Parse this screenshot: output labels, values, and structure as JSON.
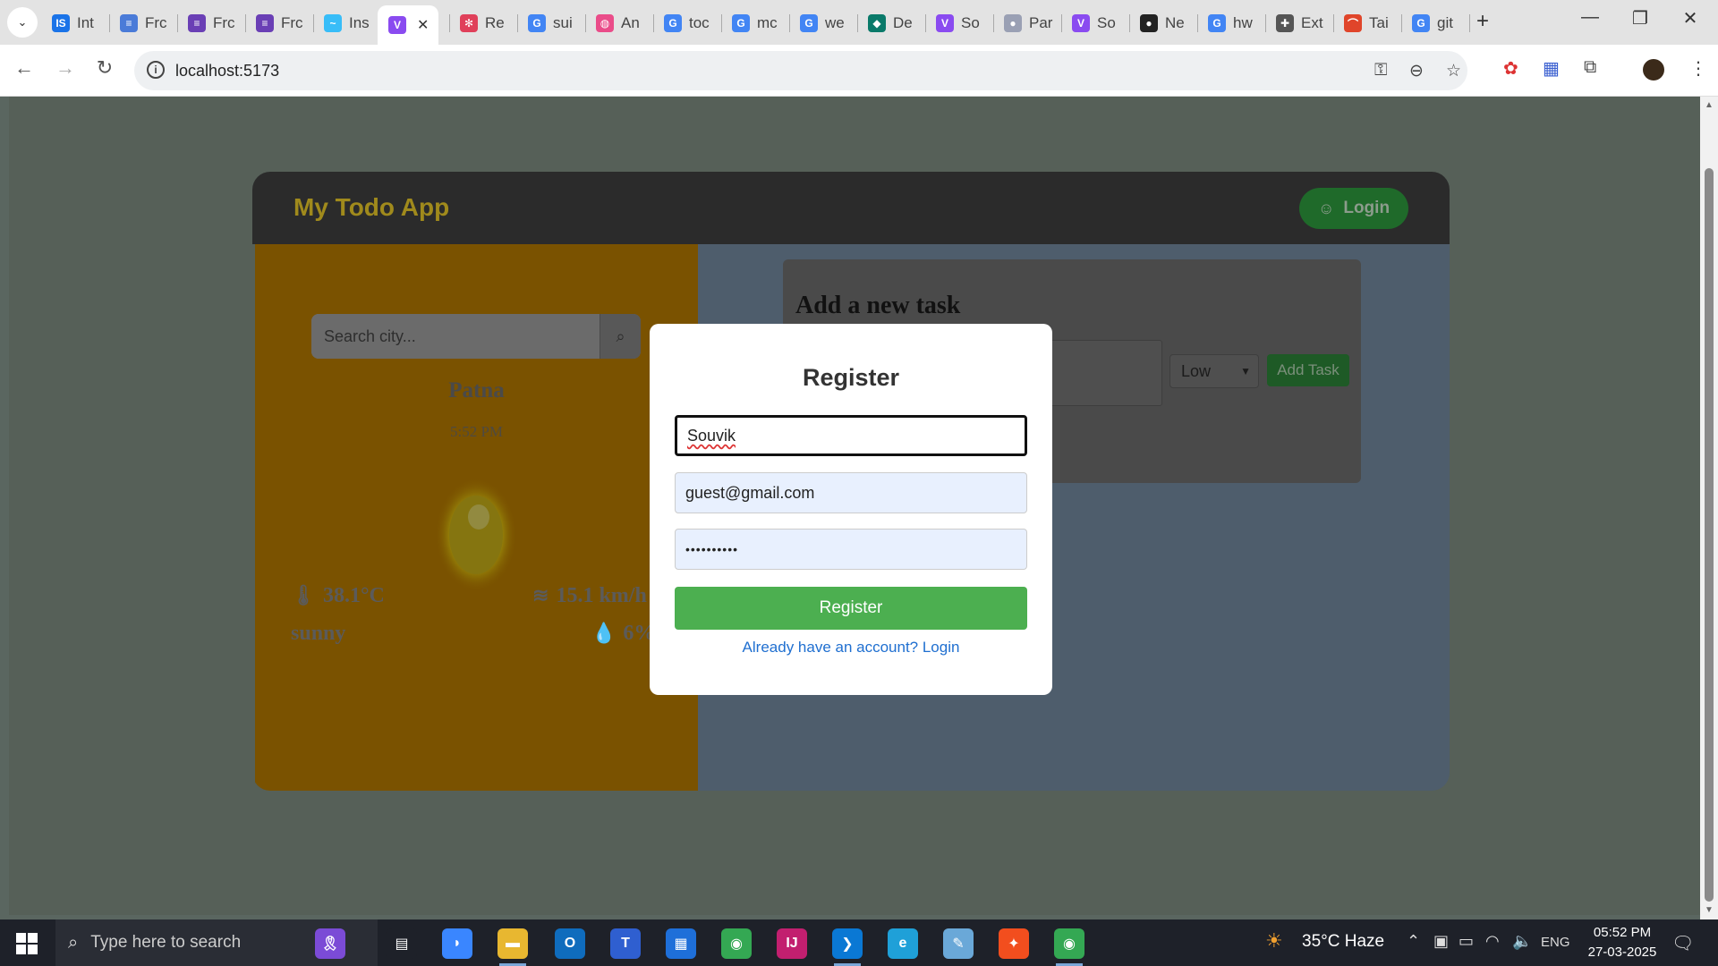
{
  "browser": {
    "tabs": [
      {
        "title": "Int",
        "icon": "indeed-icon",
        "color": "#1a73e8",
        "glyph": "IS"
      },
      {
        "title": "Frc",
        "icon": "docs-icon",
        "color": "#4a7bd8",
        "glyph": "≡"
      },
      {
        "title": "Frc",
        "icon": "forms-icon",
        "color": "#6a3fb5",
        "glyph": "≡"
      },
      {
        "title": "Frc",
        "icon": "forms-icon",
        "color": "#6a3fb5",
        "glyph": "≡"
      },
      {
        "title": "Ins",
        "icon": "tailwind-icon",
        "color": "#38bdf8",
        "glyph": "~"
      },
      {
        "title": "",
        "icon": "vite-icon",
        "color": "#8a4bf0",
        "glyph": "V",
        "active": true
      },
      {
        "title": "Re",
        "icon": "react-icon",
        "color": "#e0405a",
        "glyph": "✻"
      },
      {
        "title": "sui",
        "icon": "google-icon",
        "color": "#4285f4",
        "glyph": "G"
      },
      {
        "title": "An",
        "icon": "dribbble-icon",
        "color": "#ea4c89",
        "glyph": "◍"
      },
      {
        "title": "toc",
        "icon": "google-icon",
        "color": "#4285f4",
        "glyph": "G"
      },
      {
        "title": "mc",
        "icon": "google-icon",
        "color": "#4285f4",
        "glyph": "G"
      },
      {
        "title": "we",
        "icon": "google-icon",
        "color": "#4285f4",
        "glyph": "G"
      },
      {
        "title": "De",
        "icon": "deepseek-icon",
        "color": "#0a7a6a",
        "glyph": "◆"
      },
      {
        "title": "So",
        "icon": "vite-icon",
        "color": "#8a4bf0",
        "glyph": "V"
      },
      {
        "title": "Par",
        "icon": "globe-icon",
        "color": "#9aa0b4",
        "glyph": "●"
      },
      {
        "title": "So",
        "icon": "vite-icon",
        "color": "#8a4bf0",
        "glyph": "V"
      },
      {
        "title": "Ne",
        "icon": "github-icon",
        "color": "#222222",
        "glyph": "●"
      },
      {
        "title": "hw",
        "icon": "google-icon",
        "color": "#4285f4",
        "glyph": "G"
      },
      {
        "title": "Ext",
        "icon": "puzzle-icon",
        "color": "#555555",
        "glyph": "✚"
      },
      {
        "title": "Tai",
        "icon": "rainbow-icon",
        "color": "#e0452a",
        "glyph": "⌒"
      },
      {
        "title": "git",
        "icon": "google-icon",
        "color": "#4285f4",
        "glyph": "G"
      }
    ],
    "new_tab": "+",
    "url": "localhost:5173",
    "controls": {
      "minimize": "—",
      "restore": "❐",
      "close": "✕"
    }
  },
  "app": {
    "title": "My Todo App",
    "login_label": "Login"
  },
  "weather": {
    "search_placeholder": "Search city...",
    "city": "Patna",
    "time": "5:52 PM",
    "temperature": "38.1°C",
    "wind": "15.1 km/h",
    "condition": "sunny",
    "humidity": "6%"
  },
  "tasks": {
    "heading": "Add a new task",
    "priority_selected": "Low",
    "add_label": "Add Task"
  },
  "modal": {
    "title": "Register",
    "name_value": "Souvik",
    "email_value": "guest@gmail.com",
    "password_masked": "••••••••••",
    "submit_label": "Register",
    "switch_link": "Already have an account? Login"
  },
  "taskbar": {
    "search_placeholder": "Type here to search",
    "weather": "35°C  Haze",
    "language": "ENG",
    "time": "05:52 PM",
    "date": "27-03-2025",
    "apps": [
      {
        "name": "ribbon-icon",
        "color": "#7b4bd6",
        "glyph": "🎗"
      },
      {
        "name": "task-view-icon",
        "color": "#1e2129",
        "glyph": "▤"
      },
      {
        "name": "copilot-icon",
        "color": "#3a86ff",
        "glyph": "◗"
      },
      {
        "name": "file-explorer-icon",
        "color": "#e8b730",
        "glyph": "▬",
        "active": true
      },
      {
        "name": "outlook-icon",
        "color": "#0f6cbd",
        "glyph": "O"
      },
      {
        "name": "teams-icon",
        "color": "#2f5fd0",
        "glyph": "T"
      },
      {
        "name": "store-icon",
        "color": "#1e6fd9",
        "glyph": "▦"
      },
      {
        "name": "chrome-icon",
        "color": "#34a853",
        "glyph": "◉"
      },
      {
        "name": "intellij-icon",
        "color": "#c21f6f",
        "glyph": "IJ"
      },
      {
        "name": "vscode-icon",
        "color": "#0a78d4",
        "glyph": "❯",
        "active": true
      },
      {
        "name": "edge-icon",
        "color": "#1fa0d8",
        "glyph": "e"
      },
      {
        "name": "notepad-icon",
        "color": "#6aa8d8",
        "glyph": "✎"
      },
      {
        "name": "figma-icon",
        "color": "#f24e1e",
        "glyph": "✦"
      },
      {
        "name": "chrome-active-icon",
        "color": "#34a853",
        "glyph": "◉",
        "active": true
      }
    ]
  }
}
